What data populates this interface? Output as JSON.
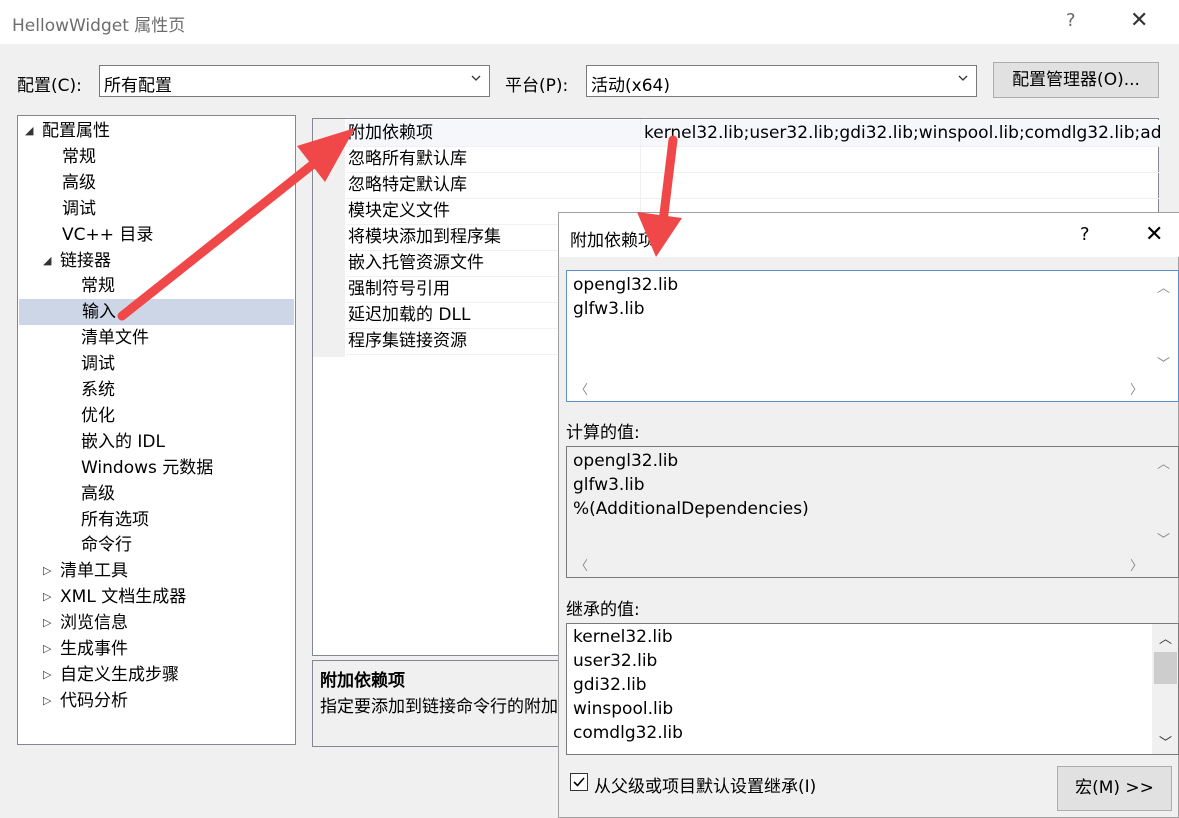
{
  "window": {
    "title": "HellowWidget 属性页",
    "help": "?",
    "close": "✕"
  },
  "toolbar": {
    "config_label": "配置(C):",
    "config_value": "所有配置",
    "platform_label": "平台(P):",
    "platform_value": "活动(x64)",
    "config_manager": "配置管理器(O)..."
  },
  "tree": {
    "items": [
      {
        "label": "配置属性",
        "expander": "◢"
      },
      {
        "label": "常规"
      },
      {
        "label": "高级"
      },
      {
        "label": "调试"
      },
      {
        "label": "VC++ 目录"
      },
      {
        "label": "链接器",
        "expander": "◢"
      },
      {
        "label": "常规"
      },
      {
        "label": "输入",
        "selected": true
      },
      {
        "label": "清单文件"
      },
      {
        "label": "调试"
      },
      {
        "label": "系统"
      },
      {
        "label": "优化"
      },
      {
        "label": "嵌入的 IDL"
      },
      {
        "label": "Windows 元数据"
      },
      {
        "label": "高级"
      },
      {
        "label": "所有选项"
      },
      {
        "label": "命令行"
      },
      {
        "label": "清单工具",
        "expander": "▷"
      },
      {
        "label": "XML 文档生成器",
        "expander": "▷"
      },
      {
        "label": "浏览信息",
        "expander": "▷"
      },
      {
        "label": "生成事件",
        "expander": "▷"
      },
      {
        "label": "自定义生成步骤",
        "expander": "▷"
      },
      {
        "label": "代码分析",
        "expander": "▷"
      }
    ]
  },
  "props": {
    "rows": [
      {
        "name": "附加依赖项",
        "value": "kernel32.lib;user32.lib;gdi32.lib;winspool.lib;comdlg32.lib;ad"
      },
      {
        "name": "忽略所有默认库",
        "value": ""
      },
      {
        "name": "忽略特定默认库",
        "value": ""
      },
      {
        "name": "模块定义文件",
        "value": ""
      },
      {
        "name": "将模块添加到程序集",
        "value": ""
      },
      {
        "name": "嵌入托管资源文件",
        "value": ""
      },
      {
        "name": "强制符号引用",
        "value": ""
      },
      {
        "name": "延迟加载的 DLL",
        "value": ""
      },
      {
        "name": "程序集链接资源",
        "value": ""
      }
    ]
  },
  "description": {
    "title": "附加依赖项",
    "text": "指定要添加到链接命令行的附加"
  },
  "dialog": {
    "title": "附加依赖项",
    "help": "?",
    "close": "✕",
    "edit_lines": [
      "opengl32.lib",
      "glfw3.lib"
    ],
    "computed_label": "计算的值:",
    "computed_lines": [
      "opengl32.lib",
      "glfw3.lib",
      "%(AdditionalDependencies)"
    ],
    "inherited_label": "继承的值:",
    "inherited_lines": [
      "kernel32.lib",
      "user32.lib",
      "gdi32.lib",
      "winspool.lib",
      "comdlg32.lib"
    ],
    "inherit_checkbox": "从父级或项目默认设置继承(I)",
    "inherit_checked": true,
    "macros_button": "宏(M) >>"
  },
  "colors": {
    "annotation_arrow": "#f04848",
    "selection": "#cdd6e6"
  }
}
